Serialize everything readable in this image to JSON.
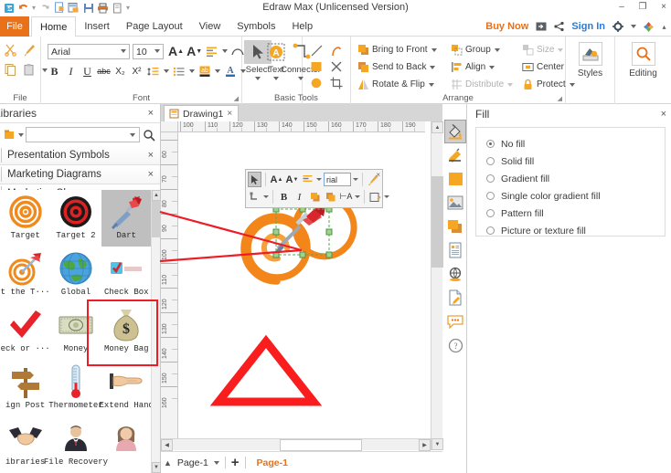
{
  "window": {
    "title": "Edraw Max (Unlicensed Version)",
    "minimize": "–",
    "maximize": "❐",
    "close": "×"
  },
  "quick_access": [
    {
      "name": "edraw-logo-icon",
      "glyph": "E"
    },
    {
      "name": "undo-icon",
      "glyph": "↶"
    },
    {
      "name": "undo-dropdown-icon",
      "glyph": "▾"
    },
    {
      "name": "redo-icon",
      "glyph": "↷"
    },
    {
      "name": "new-file-icon",
      "glyph": "⬜"
    },
    {
      "name": "open-file-icon",
      "glyph": "⬜"
    },
    {
      "name": "save-icon",
      "glyph": "⬜"
    },
    {
      "name": "print-icon",
      "glyph": "⎙"
    },
    {
      "name": "print-preview-icon",
      "glyph": "⬜"
    },
    {
      "name": "customize-qat-icon",
      "glyph": "▾"
    }
  ],
  "menu": {
    "file_tab": "File",
    "tabs": [
      {
        "label": "Home",
        "active": true
      },
      {
        "label": "Insert",
        "active": false
      },
      {
        "label": "Page Layout",
        "active": false
      },
      {
        "label": "View",
        "active": false
      },
      {
        "label": "Symbols",
        "active": false
      },
      {
        "label": "Help",
        "active": false
      }
    ],
    "buy_now": "Buy Now",
    "sign_in": "Sign In",
    "share_icon": "share-icon",
    "export_icon": "export-icon",
    "settings_icon": "gear-icon",
    "help_icon": "colorful-help-icon"
  },
  "ribbon": {
    "groups": [
      {
        "name": "file",
        "label": "File"
      },
      {
        "name": "font",
        "label": "Font"
      },
      {
        "name": "basic_tools",
        "label": "Basic Tools"
      },
      {
        "name": "arrange",
        "label": "Arrange"
      }
    ],
    "font": {
      "family": "Arial",
      "size": "10",
      "grow_font": "A",
      "shrink_font": "A",
      "bold": "B",
      "italic": "I",
      "underline": "U",
      "strikethrough": "abc",
      "subscript": "X₂",
      "superscript": "X²",
      "line_spacing": "line-spacing-icon",
      "bullets": "bullet-list-icon",
      "highlight": "text-highlight-icon",
      "font_color": "font-color-icon",
      "align": "align-icon",
      "curve_text": "curved-text-icon"
    },
    "basic_tools": [
      {
        "label": "Select",
        "icon": "cursor-arrow-icon"
      },
      {
        "label": "Text",
        "icon": "text-tool-icon"
      },
      {
        "label": "Connector",
        "icon": "connector-icon"
      }
    ],
    "shape_tools": [
      {
        "name": "line-tool-icon"
      },
      {
        "name": "arc-tool-icon"
      },
      {
        "name": "rectangle-tool-icon"
      },
      {
        "name": "close-shape-icon"
      },
      {
        "name": "ellipse-tool-icon"
      },
      {
        "name": "crop-tool-icon"
      }
    ],
    "arrange": {
      "col1": [
        {
          "label": "Bring to Front",
          "icon": "bring-front-icon",
          "dropdown": true,
          "disabled": false
        },
        {
          "label": "Send to Back",
          "icon": "send-back-icon",
          "dropdown": true,
          "disabled": false
        },
        {
          "label": "Rotate & Flip",
          "icon": "rotate-flip-icon",
          "dropdown": true,
          "disabled": false
        }
      ],
      "col2": [
        {
          "label": "Group",
          "icon": "group-icon",
          "dropdown": true,
          "disabled": false
        },
        {
          "label": "Align",
          "icon": "align-objects-icon",
          "dropdown": true,
          "disabled": false
        },
        {
          "label": "Distribute",
          "icon": "distribute-icon",
          "dropdown": true,
          "disabled": true
        }
      ],
      "col3": [
        {
          "label": "Size",
          "icon": "size-icon",
          "dropdown": true,
          "disabled": true
        },
        {
          "label": "Center",
          "icon": "center-icon",
          "dropdown": false,
          "disabled": false
        },
        {
          "label": "Protect",
          "icon": "lock-icon",
          "dropdown": true,
          "disabled": false
        }
      ]
    },
    "styles": {
      "label": "Styles",
      "icon": "styles-icon"
    },
    "editing": {
      "label": "Editing",
      "icon": "magnifier-icon"
    }
  },
  "libraries": {
    "title": "Libraries",
    "close": "×",
    "search_placeholder": "",
    "search_value": "",
    "search_icon": "magnifier-icon",
    "library_dropdown_icon": "library-dropdown-icon",
    "categories": [
      {
        "label": "Presentation Symbols",
        "close": "×"
      },
      {
        "label": "Marketing Diagrams",
        "close": "×"
      },
      {
        "label": "Marketing Shapes",
        "close": "×"
      }
    ],
    "shapes": [
      {
        "label": "Target",
        "icon": "target-orange-icon",
        "selected": false
      },
      {
        "label": "Target 2",
        "icon": "target-black-red-icon",
        "selected": false
      },
      {
        "label": "Dart",
        "icon": "dart-icon",
        "selected": true
      },
      {
        "label": "t the T···",
        "icon": "hit-the-target-icon",
        "selected": false
      },
      {
        "label": "Global",
        "icon": "globe-icon",
        "selected": false
      },
      {
        "label": "Check Box",
        "icon": "check-box-icon",
        "selected": false
      },
      {
        "label": "eck or ···",
        "icon": "red-check-icon",
        "selected": false
      },
      {
        "label": "Money",
        "icon": "money-bill-icon",
        "selected": false
      },
      {
        "label": "Money Bag",
        "icon": "money-bag-icon",
        "selected": false
      },
      {
        "label": "ign Post",
        "icon": "sign-post-icon",
        "selected": false
      },
      {
        "label": "Thermometer",
        "icon": "thermometer-icon",
        "selected": false
      },
      {
        "label": "Extend Hand",
        "icon": "pointing-hand-icon",
        "selected": false
      },
      {
        "label": "ibraries",
        "icon": "handshake-icon",
        "selected": false
      },
      {
        "label": "File Recovery",
        "icon": "businessman-icon",
        "selected": false
      },
      {
        "label": "",
        "icon": "businesswoman-icon",
        "selected": false
      }
    ]
  },
  "canvas": {
    "document_tab": {
      "label": "Drawing1",
      "close": "×",
      "icon": "document-icon"
    },
    "h_ruler_ticks": [
      "100",
      "110",
      "120",
      "130",
      "140",
      "150",
      "160",
      "170",
      "180",
      "190"
    ],
    "v_ruler_ticks": [
      "60",
      "70",
      "80",
      "90",
      "100",
      "110",
      "120",
      "130",
      "140",
      "150",
      "160"
    ],
    "shapes": [
      {
        "name": "target-shape",
        "type": "spiral-target"
      },
      {
        "name": "dart-shape",
        "type": "dart",
        "selected": true
      },
      {
        "name": "triangle-shape",
        "type": "triangle-outline",
        "color": "#f91d1d"
      }
    ],
    "scroll_up": "▲",
    "scroll_down": "▼",
    "scroll_left": "◀",
    "scroll_right": "▶"
  },
  "page_bar": {
    "collapse_icon": "ⱏ",
    "page_name": "Page-1",
    "add_page": "+",
    "active_tab": "Page-1"
  },
  "float_toolbar": {
    "close": "×",
    "font_value": "rial",
    "row1": [
      {
        "name": "select-tool-icon",
        "glyph": "➤",
        "selected": true
      },
      {
        "name": "grow-font-icon",
        "glyph": "A"
      },
      {
        "name": "shrink-font-icon",
        "glyph": "A"
      },
      {
        "name": "align-icon",
        "glyph": "≡"
      },
      {
        "name": "format-painter-icon",
        "glyph": "✎"
      }
    ],
    "row2": [
      {
        "name": "connector-tool-icon",
        "glyph": "⮡"
      },
      {
        "name": "bold-icon",
        "glyph": "B"
      },
      {
        "name": "italic-icon",
        "glyph": "I"
      },
      {
        "name": "bring-front-icon",
        "glyph": "▣"
      },
      {
        "name": "send-back-icon",
        "glyph": "▣"
      },
      {
        "name": "align-left-icon",
        "glyph": "⊢A"
      },
      {
        "name": "line-style-icon",
        "glyph": "◱"
      }
    ]
  },
  "side_toolbar": [
    {
      "name": "fill-icon",
      "active": true
    },
    {
      "name": "line-style-icon",
      "active": false
    },
    {
      "name": "solid-color-icon",
      "active": false
    },
    {
      "name": "picture-icon",
      "active": false
    },
    {
      "name": "shadow-icon",
      "active": false
    },
    {
      "name": "document-properties-icon",
      "active": false
    },
    {
      "name": "hyperlink-icon",
      "active": false
    },
    {
      "name": "page-edit-icon",
      "active": false
    },
    {
      "name": "comment-icon",
      "active": false
    },
    {
      "name": "help-circle-icon",
      "active": false
    }
  ],
  "fill_panel": {
    "title": "Fill",
    "close": "×",
    "options": [
      {
        "label": "No fill",
        "selected": true
      },
      {
        "label": "Solid fill",
        "selected": false
      },
      {
        "label": "Gradient fill",
        "selected": false
      },
      {
        "label": "Single color gradient fill",
        "selected": false
      },
      {
        "label": "Pattern fill",
        "selected": false
      },
      {
        "label": "Picture or texture fill",
        "selected": false
      }
    ]
  },
  "colors": {
    "accent_orange": "#e8711a",
    "link_blue": "#2b7cd3",
    "highlight_red": "#ee1c24",
    "triangle_red": "#f91d1d",
    "selection_green": "#5aab4b"
  }
}
